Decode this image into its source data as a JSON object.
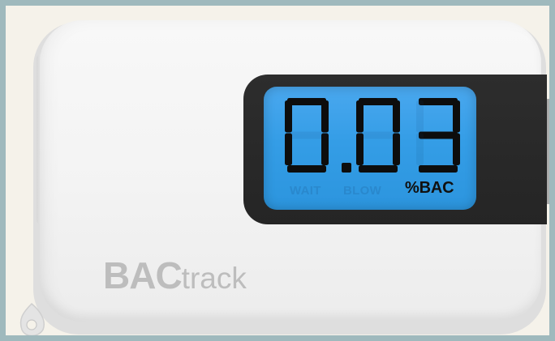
{
  "display": {
    "reading": "0.03",
    "unit": "%BAC",
    "inactive_labels": [
      "WAIT",
      "BLOW"
    ]
  },
  "brand": {
    "bold": "BAC",
    "light": "track"
  },
  "colors": {
    "lcd": "#3aa2ea",
    "bezel": "#262626",
    "body": "#f3f3f3",
    "frame_border": "#9fb9bd"
  }
}
